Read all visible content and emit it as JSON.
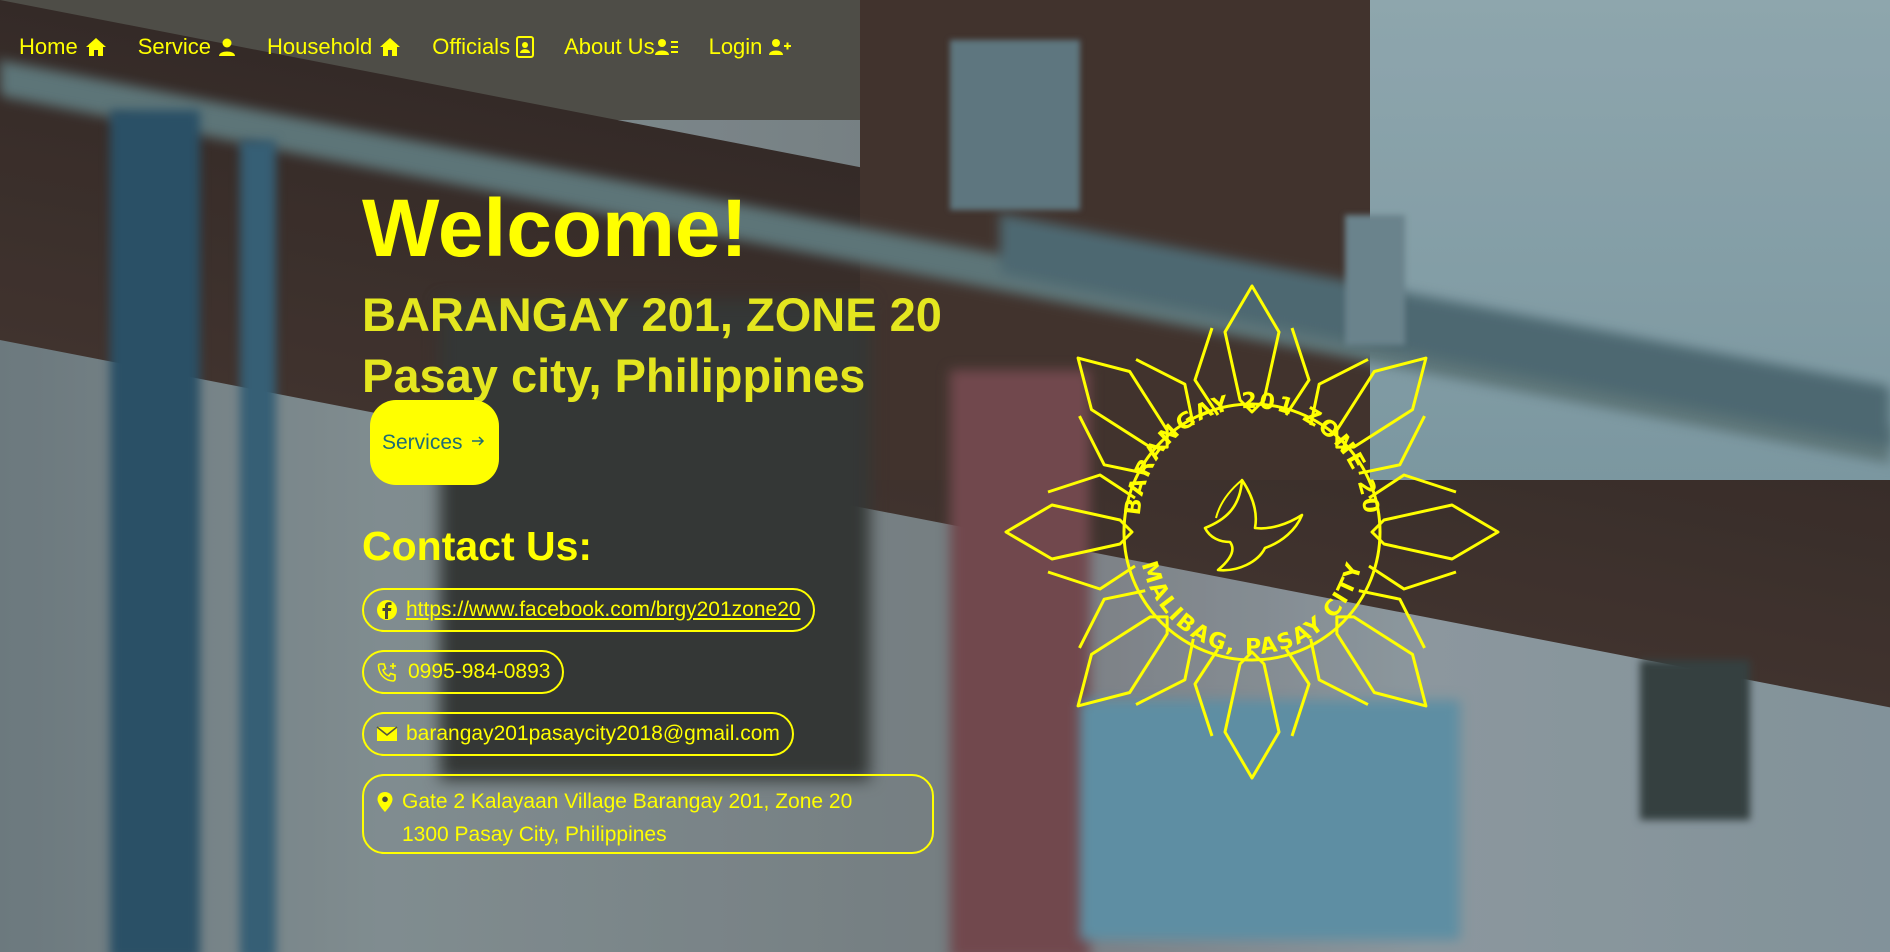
{
  "nav": {
    "items": [
      {
        "label": "Home",
        "icon": "house-icon"
      },
      {
        "label": "Service",
        "icon": "user-icon"
      },
      {
        "label": "Household",
        "icon": "house-icon"
      },
      {
        "label": "Officials",
        "icon": "id-badge-icon"
      },
      {
        "label": "About Us",
        "icon": "users-list-icon"
      },
      {
        "label": "Login",
        "icon": "user-plus-icon"
      }
    ]
  },
  "hero": {
    "welcome": "Welcome!",
    "barangay": "BARANGAY 201, ZONE 20 Pasay city, Philippines",
    "services_button": "Services",
    "contact_title": "Contact Us:"
  },
  "contacts": {
    "facebook": "https://www.facebook.com/brgy201zone20",
    "phone": "0995-984-0893",
    "email": "barangay201pasaycity2018@gmail.com",
    "address_line1": "Gate 2 Kalayaan Village Barangay 201, Zone 20",
    "address_line2": "1300 Pasay City, Philippines"
  },
  "seal": {
    "text_top": "BARANGAY 201 ZONE 20",
    "text_bottom": "MALIBAG, PASAY CITY"
  },
  "colors": {
    "accent": "#ffff00",
    "button_text": "#1f6c76"
  }
}
